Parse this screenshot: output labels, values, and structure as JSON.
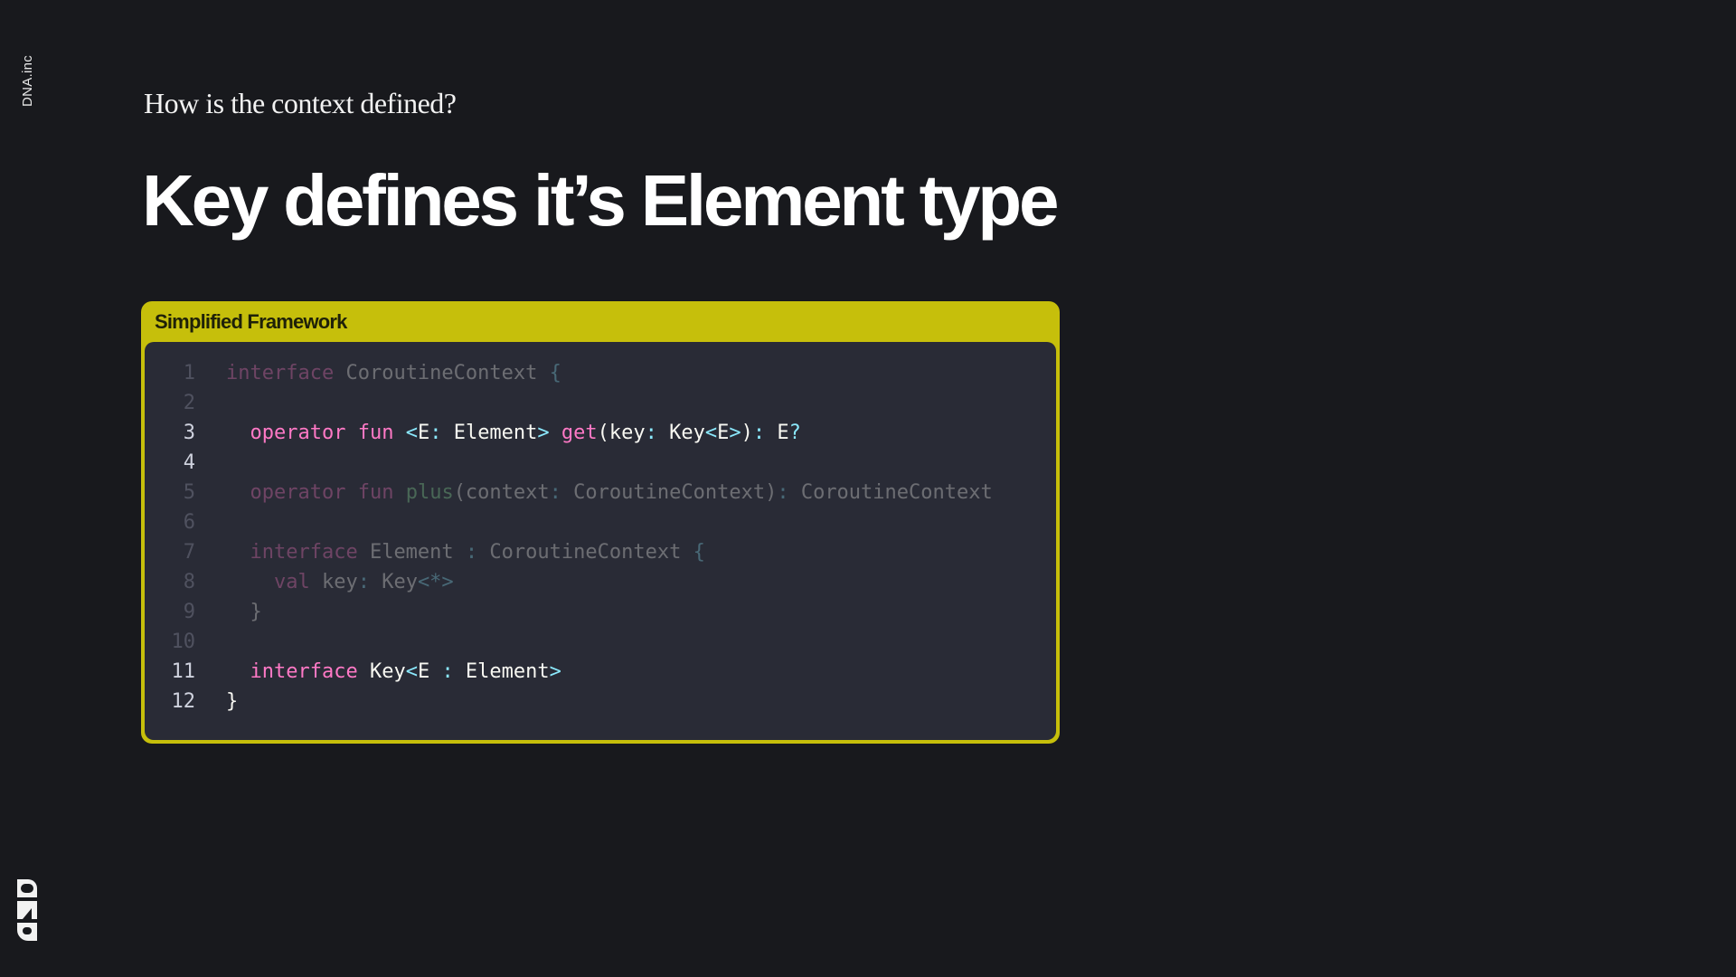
{
  "brand": {
    "name": "DNA.inc"
  },
  "slide": {
    "subtitle": "How is the context defined?",
    "title": "Key defines it’s Element type"
  },
  "code_block": {
    "label": "Simplified Framework",
    "colors": {
      "frame": "#c6bf0b",
      "panel": "#292b36",
      "keyword": "#ff79c6",
      "function": "#8ce59a",
      "punctuation": "#8be9fd",
      "text": "#f8f8f2"
    },
    "lines": [
      {
        "number": "1",
        "highlight": false,
        "tokens": [
          {
            "t": "interface",
            "c": "kw"
          },
          {
            "t": " CoroutineContext ",
            "c": "txt"
          },
          {
            "t": "{",
            "c": "punc"
          }
        ]
      },
      {
        "number": "2",
        "highlight": false,
        "tokens": []
      },
      {
        "number": "3",
        "highlight": true,
        "tokens": [
          {
            "t": "  operator",
            "c": "kw"
          },
          {
            "t": " ",
            "c": "txt"
          },
          {
            "t": "fun",
            "c": "kw"
          },
          {
            "t": " ",
            "c": "txt"
          },
          {
            "t": "<",
            "c": "punc"
          },
          {
            "t": "E",
            "c": "txt"
          },
          {
            "t": ":",
            "c": "punc"
          },
          {
            "t": " Element",
            "c": "txt"
          },
          {
            "t": ">",
            "c": "punc"
          },
          {
            "t": " ",
            "c": "txt"
          },
          {
            "t": "get",
            "c": "fn-pink"
          },
          {
            "t": "(key",
            "c": "txt"
          },
          {
            "t": ":",
            "c": "punc"
          },
          {
            "t": " Key",
            "c": "txt"
          },
          {
            "t": "<",
            "c": "punc"
          },
          {
            "t": "E",
            "c": "txt"
          },
          {
            "t": ">",
            "c": "punc"
          },
          {
            "t": ")",
            "c": "txt"
          },
          {
            "t": ":",
            "c": "punc"
          },
          {
            "t": " E",
            "c": "txt"
          },
          {
            "t": "?",
            "c": "punc"
          }
        ]
      },
      {
        "number": "4",
        "highlight": true,
        "tokens": []
      },
      {
        "number": "5",
        "highlight": false,
        "tokens": [
          {
            "t": "  operator",
            "c": "kw"
          },
          {
            "t": " ",
            "c": "txt"
          },
          {
            "t": "fun",
            "c": "kw"
          },
          {
            "t": " ",
            "c": "txt"
          },
          {
            "t": "plus",
            "c": "fn-green"
          },
          {
            "t": "(context",
            "c": "txt"
          },
          {
            "t": ":",
            "c": "punc"
          },
          {
            "t": " CoroutineContext)",
            "c": "txt"
          },
          {
            "t": ":",
            "c": "punc"
          },
          {
            "t": " CoroutineContext",
            "c": "txt"
          }
        ]
      },
      {
        "number": "6",
        "highlight": false,
        "tokens": []
      },
      {
        "number": "7",
        "highlight": false,
        "tokens": [
          {
            "t": "  interface",
            "c": "kw"
          },
          {
            "t": " Element ",
            "c": "txt"
          },
          {
            "t": ":",
            "c": "punc"
          },
          {
            "t": " CoroutineContext ",
            "c": "txt"
          },
          {
            "t": "{",
            "c": "punc"
          }
        ]
      },
      {
        "number": "8",
        "highlight": false,
        "tokens": [
          {
            "t": "    val",
            "c": "kw"
          },
          {
            "t": " key",
            "c": "txt"
          },
          {
            "t": ":",
            "c": "punc"
          },
          {
            "t": " Key",
            "c": "txt"
          },
          {
            "t": "<*>",
            "c": "punc"
          }
        ]
      },
      {
        "number": "9",
        "highlight": false,
        "tokens": [
          {
            "t": "  }",
            "c": "txt"
          }
        ]
      },
      {
        "number": "10",
        "highlight": false,
        "tokens": []
      },
      {
        "number": "11",
        "highlight": true,
        "tokens": [
          {
            "t": "  interface",
            "c": "kw"
          },
          {
            "t": " Key",
            "c": "txt"
          },
          {
            "t": "<",
            "c": "punc"
          },
          {
            "t": "E ",
            "c": "txt"
          },
          {
            "t": ":",
            "c": "punc"
          },
          {
            "t": " Element",
            "c": "txt"
          },
          {
            "t": ">",
            "c": "punc"
          }
        ]
      },
      {
        "number": "12",
        "highlight": true,
        "tokens": [
          {
            "t": "}",
            "c": "txt"
          }
        ]
      }
    ]
  },
  "logo": {
    "icon": "dna-logo-icon"
  }
}
